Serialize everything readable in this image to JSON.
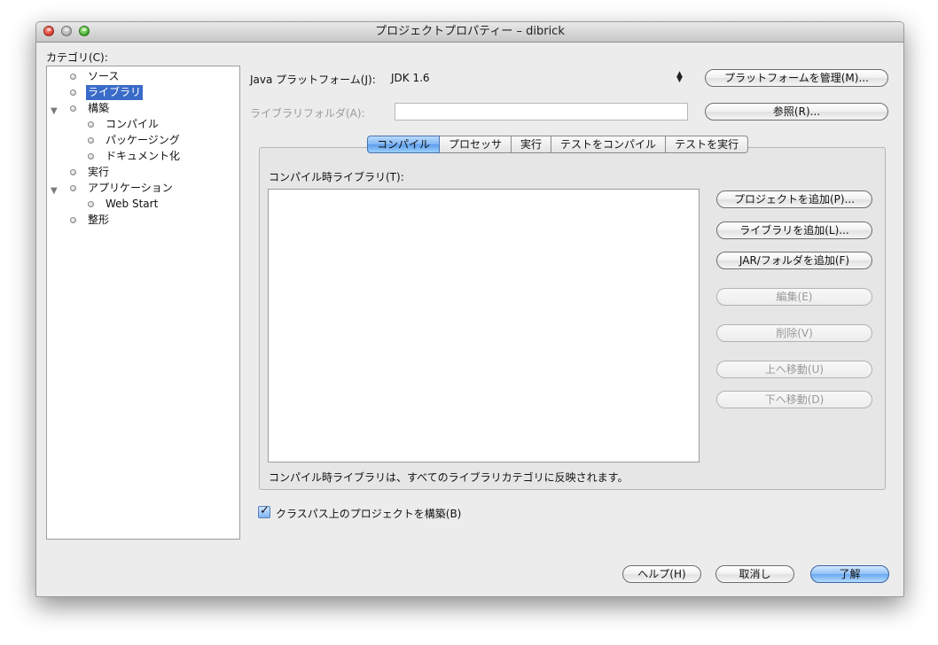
{
  "window": {
    "title": "プロジェクトプロパティー – dibrick"
  },
  "categories": {
    "label": "カテゴリ(C):",
    "items": [
      {
        "label": "ソース",
        "level": 0,
        "expander": false,
        "selected": false
      },
      {
        "label": "ライブラリ",
        "level": 0,
        "expander": false,
        "selected": true
      },
      {
        "label": "構築",
        "level": 0,
        "expander": true,
        "selected": false
      },
      {
        "label": "コンパイル",
        "level": 1,
        "expander": false,
        "selected": false
      },
      {
        "label": "パッケージング",
        "level": 1,
        "expander": false,
        "selected": false
      },
      {
        "label": "ドキュメント化",
        "level": 1,
        "expander": false,
        "selected": false
      },
      {
        "label": "実行",
        "level": 0,
        "expander": false,
        "selected": false
      },
      {
        "label": "アプリケーション",
        "level": 0,
        "expander": true,
        "selected": false
      },
      {
        "label": "Web Start",
        "level": 1,
        "expander": false,
        "selected": false
      },
      {
        "label": "整形",
        "level": 0,
        "expander": false,
        "selected": false
      }
    ]
  },
  "platform": {
    "label": "Java プラットフォーム(J):",
    "value": "JDK 1.6",
    "manage_button": "プラットフォームを管理(M)..."
  },
  "library_folder": {
    "label": "ライブラリフォルダ(A):",
    "value": "",
    "browse_button": "参照(R)..."
  },
  "tabs": [
    "コンパイル",
    "プロセッサ",
    "実行",
    "テストをコンパイル",
    "テストを実行"
  ],
  "active_tab": 0,
  "compile": {
    "list_label": "コンパイル時ライブラリ(T):",
    "note": "コンパイル時ライブラリは、すべてのライブラリカテゴリに反映されます。",
    "buttons": {
      "add_project": "プロジェクトを追加(P)...",
      "add_library": "ライブラリを追加(L)...",
      "add_jar": "JAR/フォルダを追加(F)",
      "edit": "編集(E)",
      "remove": "削除(V)",
      "move_up": "上へ移動(U)",
      "move_down": "下へ移動(D)"
    }
  },
  "build_on_classpath": {
    "label": "クラスパス上のプロジェクトを構築(B)",
    "checked": true
  },
  "footer": {
    "help": "ヘルプ(H)",
    "cancel": "取消し",
    "ok": "了解"
  }
}
